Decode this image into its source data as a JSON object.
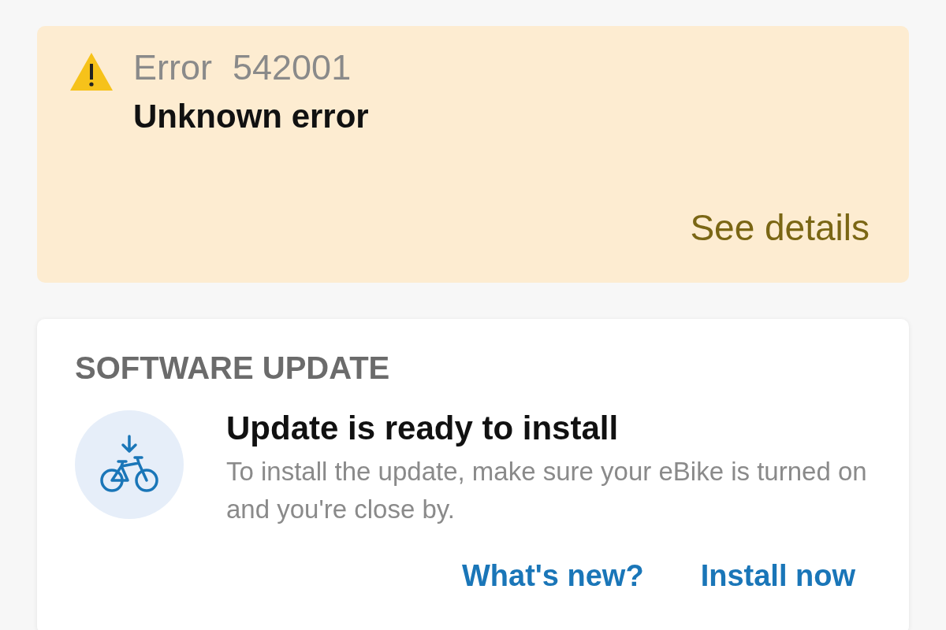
{
  "error_banner": {
    "label": "Error",
    "code": "542001",
    "message": "Unknown error",
    "action": "See details"
  },
  "software_update": {
    "heading": "SOFTWARE UPDATE",
    "title": "Update is ready to install",
    "description": "To install the update, make sure your eBike is turned on and you're close by.",
    "actions": [
      {
        "label": "What's new?"
      },
      {
        "label": "Install now"
      }
    ]
  }
}
